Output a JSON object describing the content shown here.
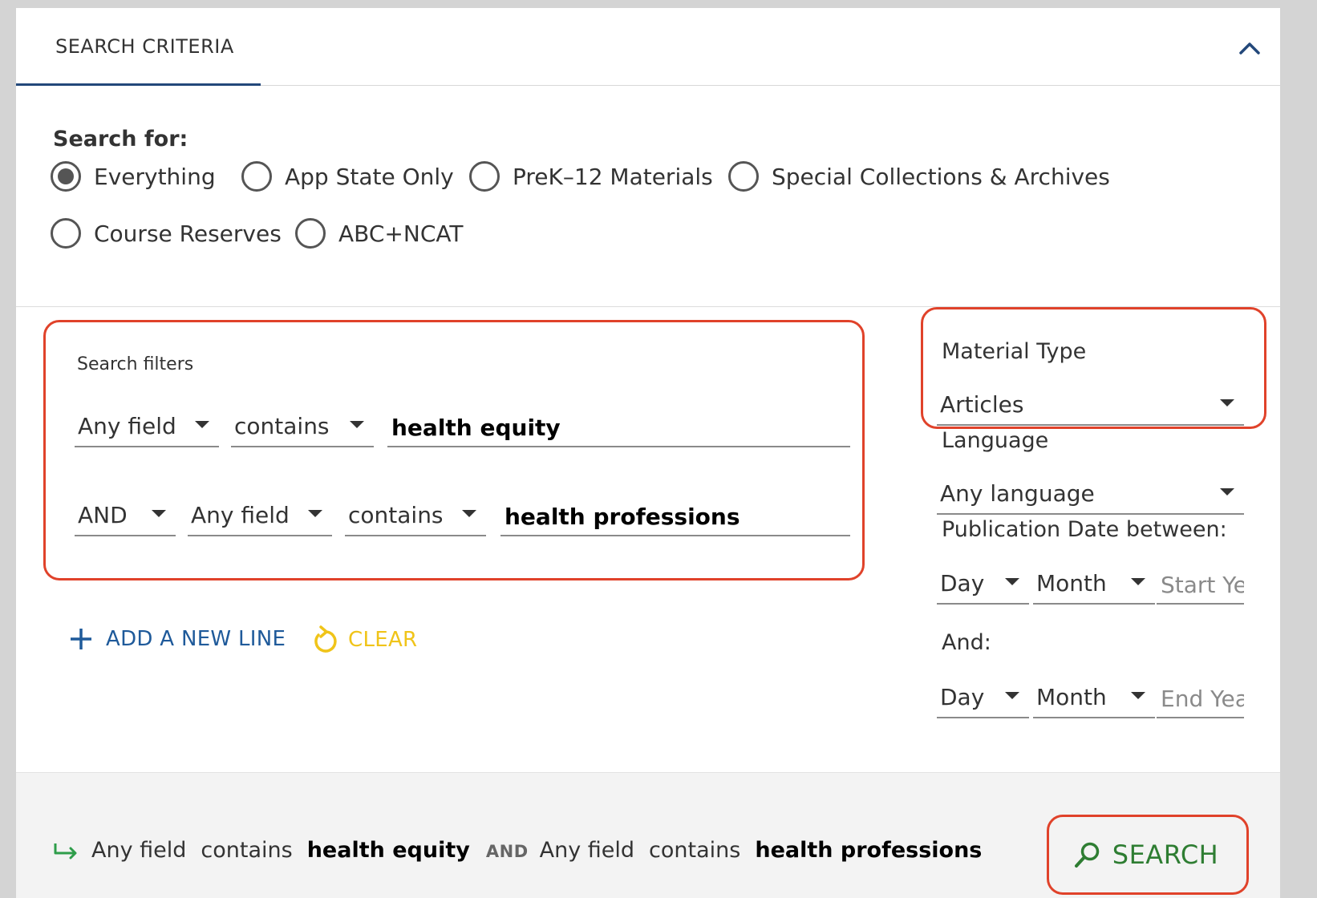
{
  "panel": {
    "tab_label": "SEARCH CRITERIA",
    "search_for_label": "Search for:",
    "scopes": [
      {
        "label": "Everything",
        "selected": true
      },
      {
        "label": "App State Only",
        "selected": false
      },
      {
        "label": "PreK–12 Materials",
        "selected": false
      },
      {
        "label": "Special Collections & Archives",
        "selected": false
      },
      {
        "label": "Course Reserves",
        "selected": false
      },
      {
        "label": "ABC+NCAT",
        "selected": false
      }
    ]
  },
  "filters": {
    "title": "Search filters",
    "row1": {
      "field": "Any field",
      "operator": "contains",
      "value": "health equity"
    },
    "row2": {
      "boolean": "AND",
      "field": "Any field",
      "operator": "contains",
      "value": "health professions"
    },
    "add_line_label": "ADD A NEW LINE",
    "clear_label": "CLEAR"
  },
  "refine": {
    "material_type_label": "Material Type",
    "material_type_value": "Articles",
    "language_label": "Language",
    "language_value": "Any language",
    "pub_date_label": "Publication Date between:",
    "start": {
      "day": "Day",
      "month": "Month",
      "year_placeholder": "Start Year"
    },
    "and_label": "And:",
    "end": {
      "day": "Day",
      "month": "Month",
      "year_placeholder": "End Year"
    }
  },
  "footer": {
    "summary": {
      "field1": "Any field",
      "op1": "contains",
      "val1": "health equity",
      "boolean": "AND",
      "field2": "Any field",
      "op2": "contains",
      "val2": "health professions"
    },
    "search_label": "SEARCH"
  },
  "colors": {
    "accent_tab": "#23487a",
    "highlight": "#e0422a",
    "add_line": "#1f5a9a",
    "clear": "#f0c419",
    "search": "#2e7d32"
  }
}
